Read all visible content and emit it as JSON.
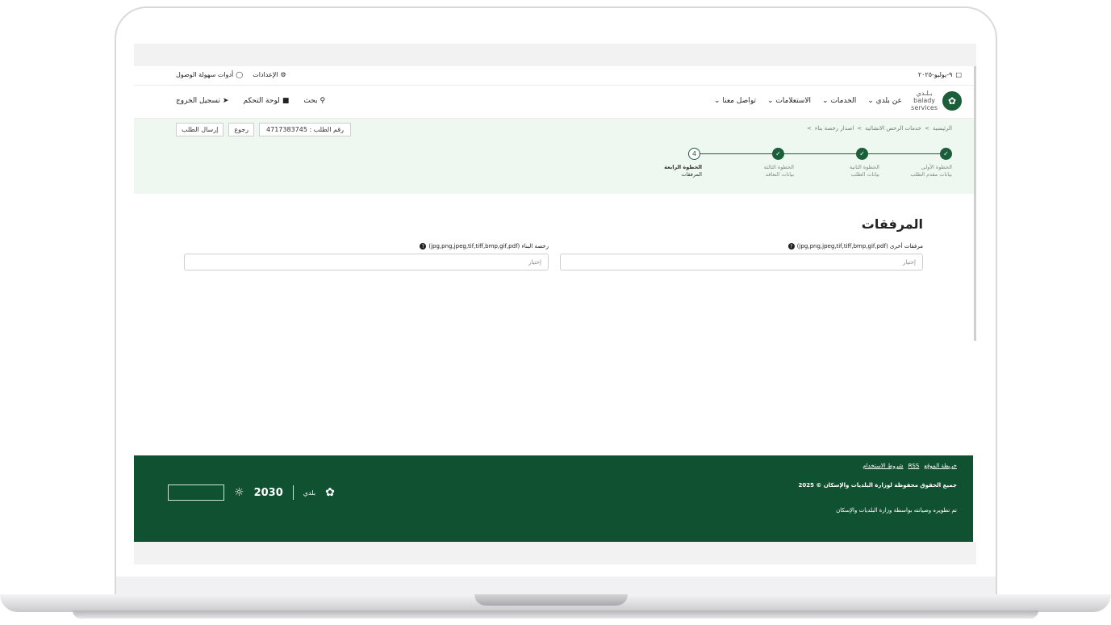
{
  "util": {
    "date": "٩-يوليو-٢٠٢٥",
    "settings": "الإعدادات",
    "accessibility": "أدوات سهولة الوصول"
  },
  "logo": {
    "line1": "بـلـدي",
    "line2": "balady",
    "line3": "services"
  },
  "menu": [
    "عن بلدي",
    "الخدمات",
    "الاستعلامات",
    "تواصل معنا"
  ],
  "nav_left": {
    "search": "بحث",
    "dashboard": "لوحة التحكم",
    "logout": "تسجيل الخروج"
  },
  "breadcrumb": [
    "الرئيسية",
    "خدمات الرخص الانشائية",
    "اصدار رخصة بناء"
  ],
  "request": {
    "id_label": "رقم الطلب : 4717383745",
    "back": "رجوع",
    "submit": "إرسال الطلب"
  },
  "steps": [
    {
      "title": "الخطوة الأولى",
      "subtitle": "بيانات مقدم الطلب",
      "status": "done"
    },
    {
      "title": "الخطوة الثانية",
      "subtitle": "بيانات الطلب",
      "status": "done"
    },
    {
      "title": "الخطوة الثالثة",
      "subtitle": "بيانات التعاقد",
      "status": "done"
    },
    {
      "title": "الخطوة الرابعة",
      "subtitle": "المرفقات",
      "status": "current",
      "number": "4"
    }
  ],
  "attachments": {
    "title": "المرفقات",
    "other_label": "مرفقات أخرى (jpg,png,jpeg,tif,tiff,bmp,gif,pdf)",
    "other_placeholder": "إختيار",
    "permit_label": "رخصة البناء (jpg,png,jpeg,tif,tiff,bmp,gif,pdf)",
    "permit_placeholder": "إختيار"
  },
  "footer": {
    "links": [
      "خريطة الموقع",
      "RSS",
      "شروط الاستخدام"
    ],
    "copyright": "جميع الحقوق محفوظة لوزارة البلديات والإسكان © 2025",
    "developed": "تم تطويره وصيانته بواسطة وزارة البلديات والإسكان",
    "logo_vision": "2030",
    "logo_balady": "بلدي"
  },
  "colors": {
    "brand": "#0f5130",
    "accent": "#1a5e3a",
    "band": "#eef8f1"
  }
}
